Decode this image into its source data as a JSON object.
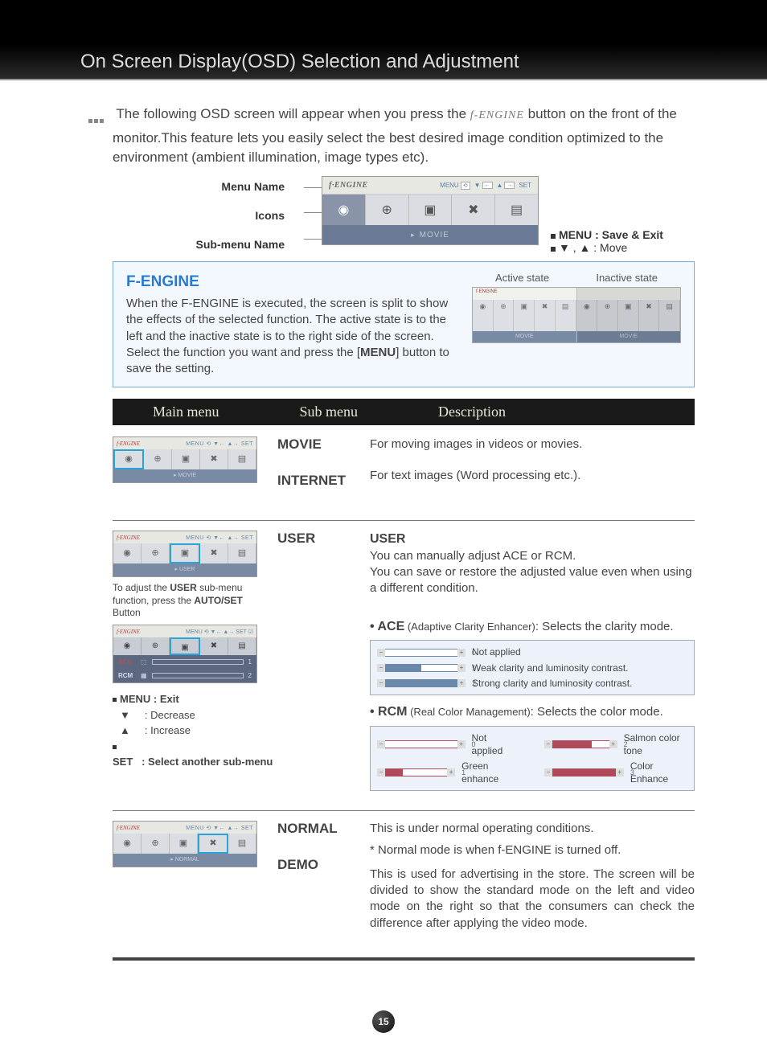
{
  "title": "On Screen Display(OSD) Selection and Adjustment",
  "intro": {
    "line1_a": "The following OSD screen will appear when you press the ",
    "fengine_label": "f-ENGINE",
    "line1_b": " button on the front of the monitor.This feature lets you easily select the best desired image condition optimized to the environment (ambient illumination, image types etc)."
  },
  "osd_diagram": {
    "labels": {
      "menu_name": "Menu Name",
      "icons": "Icons",
      "sub_menu_name": "Sub-menu Name"
    },
    "brand": "f·ENGINE",
    "header_nav": {
      "menu": "MENU",
      "set": "SET"
    },
    "sub": "MOVIE",
    "side": {
      "menu_action": "MENU : Save & Exit",
      "arrows_action": "▼ , ▲ : Move"
    }
  },
  "bluebox": {
    "title": "F-ENGINE",
    "body_a": "When the F-ENGINE is executed, the screen is split to show the effects of the selected function. The active state is to the left and the inactive state is to the right side of the screen. Select the function you want and press the [",
    "body_bold": "MENU",
    "body_b": "] button to save the setting.",
    "states": {
      "active": "Active state",
      "inactive": "Inactive state"
    },
    "mini_sub": "MOVIE"
  },
  "table_header": {
    "main": "Main menu",
    "sub": "Sub menu",
    "desc": "Description"
  },
  "sec1": {
    "sub_movie": "MOVIE",
    "desc_movie": "For moving images in videos or movies.",
    "sub_internet": "INTERNET",
    "desc_internet": "For text images (Word processing etc.).",
    "thumb_sub": "MOVIE"
  },
  "sec2": {
    "sub_user": "USER",
    "thumb_sub": "USER",
    "user_title": "USER",
    "user_body": "You can manually adjust ACE or RCM.\nYou can save or restore the adjusted value even when using a different condition.",
    "note_a": "To adjust the ",
    "note_b": "USER",
    "note_c": " sub-menu function, press the ",
    "note_d": "AUTO/SET",
    "note_e": " Button",
    "ace_title_a": "• ACE",
    "ace_title_b": " (Adaptive Clarity Enhancer)",
    "ace_title_c": ": Selects the clarity mode.",
    "ace_opts": {
      "0": "Not applied",
      "1": "Weak clarity and luminosity contrast.",
      "2": "Strong clarity and luminosity contrast."
    },
    "rcm_title_a": "• RCM",
    "rcm_title_b": " (Real Color Management)",
    "rcm_title_c": ": Selects the color mode.",
    "rcm_opts": {
      "0": "Not applied",
      "1": "Green enhance",
      "2": "Salmon color tone",
      "3": "Color Enhance"
    },
    "ace_label": "ACE",
    "rcm_label": "RCM",
    "legend": {
      "menu": "MENU : Exit",
      "down": "▼     : Decrease",
      "up": "▲     : Increase",
      "set": "SET   : Select another sub-menu"
    }
  },
  "sec3": {
    "sub_normal": "NORMAL",
    "sub_demo": "DEMO",
    "thumb_sub": "NORMAL",
    "desc_normal_a": "This is under normal operating conditions.",
    "desc_normal_b": "* Normal mode is when f-ENGINE is turned off.",
    "desc_demo": "This is used for advertising in the store. The screen will be divided to show the standard mode on the left and video mode on the right so that the consumers can check the difference after applying the video mode."
  },
  "page_number": "15"
}
